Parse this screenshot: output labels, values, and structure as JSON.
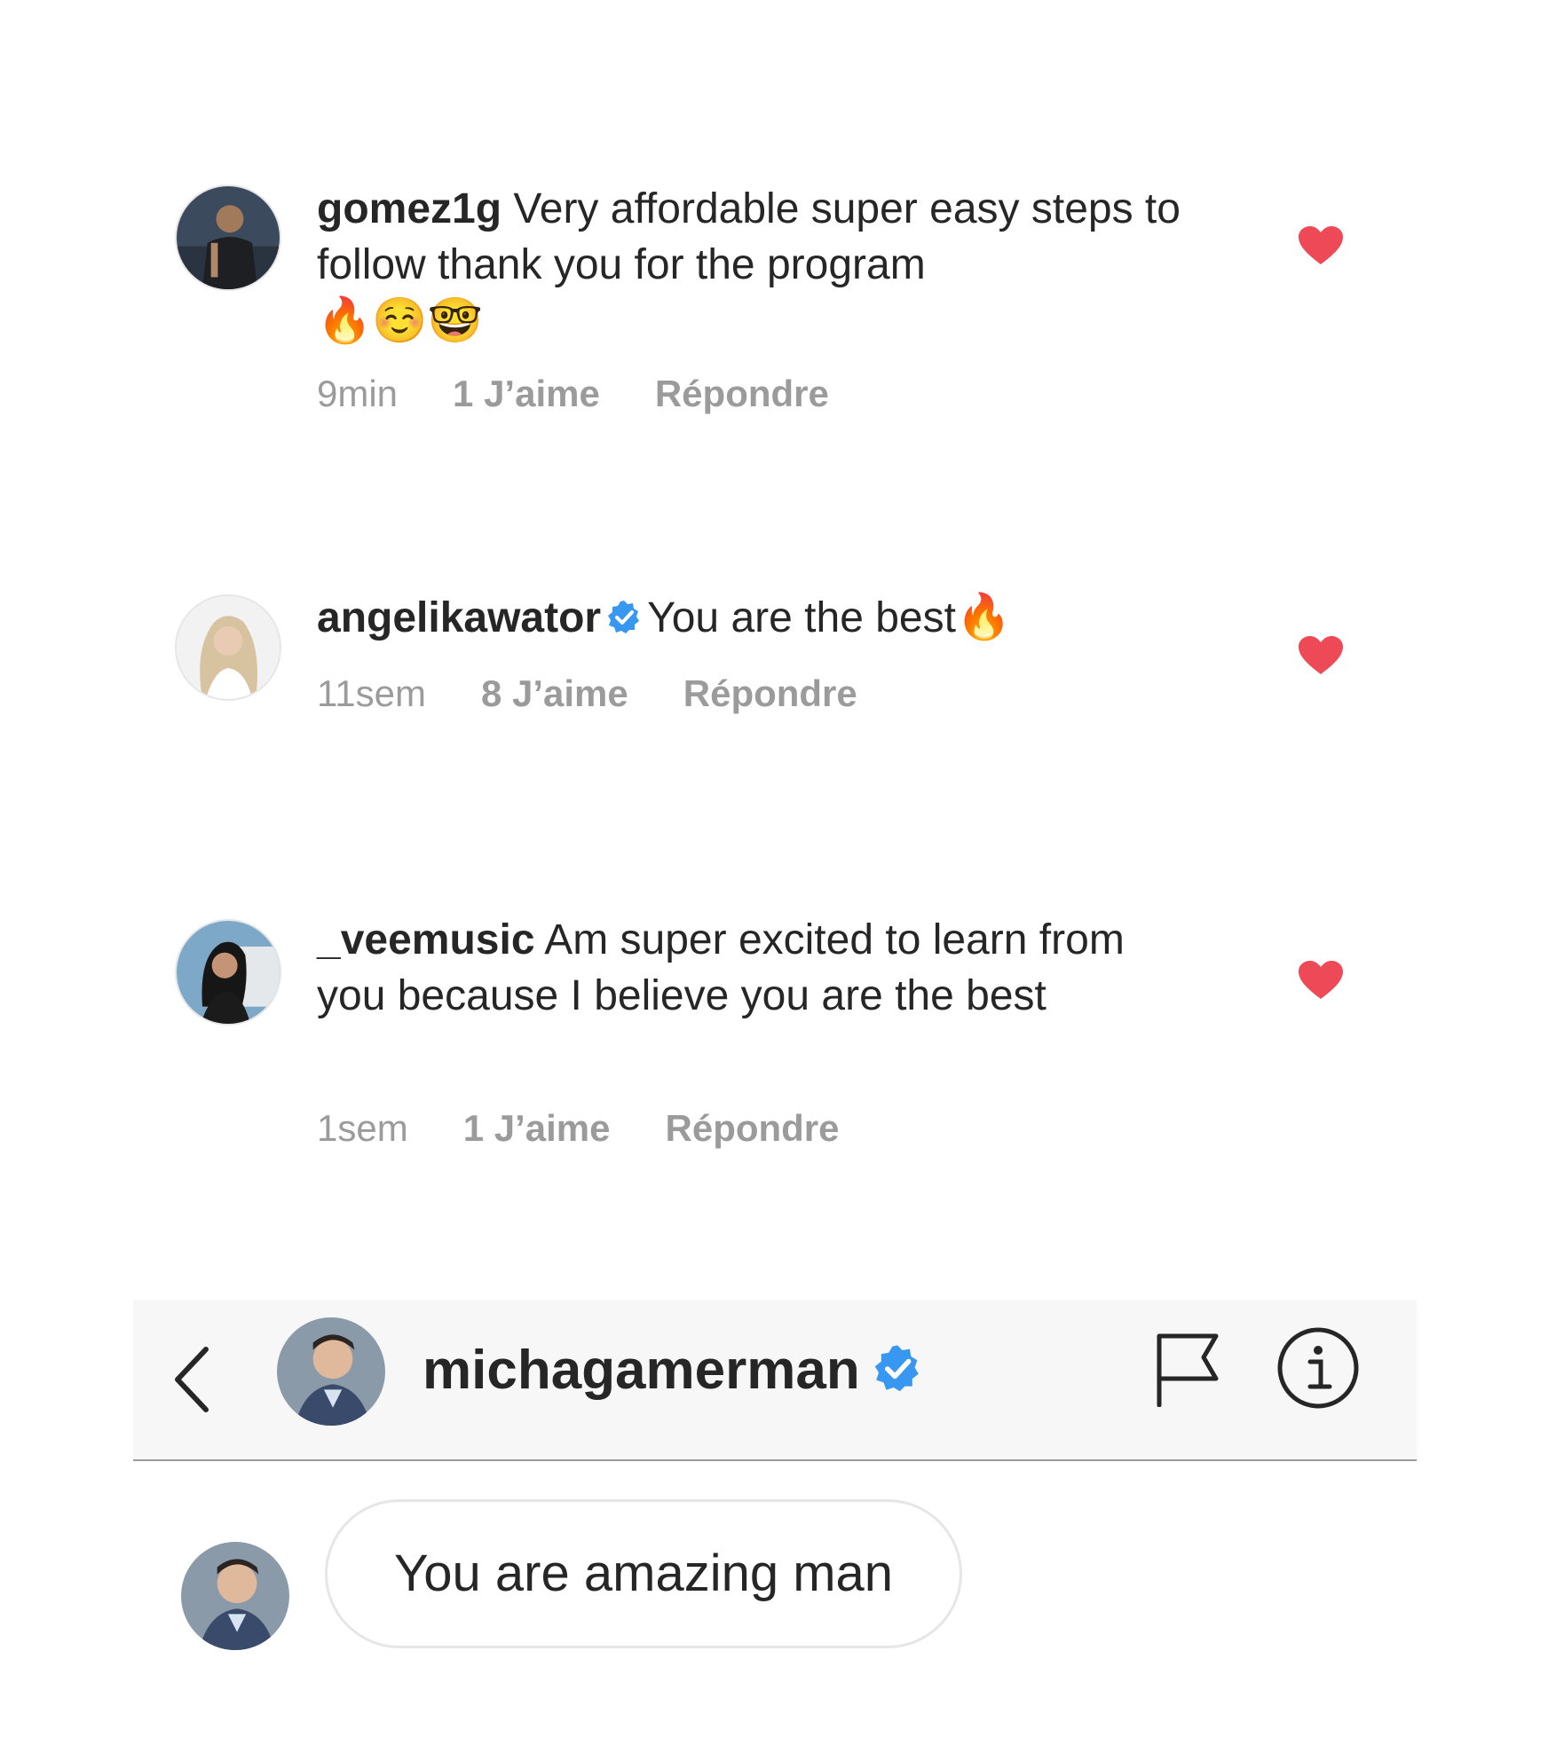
{
  "comments": [
    {
      "username": "gomez1g",
      "verified": false,
      "text": "Very affordable super easy steps to follow thank you for the program",
      "emojis": "🔥☺️🤓",
      "time": "9min",
      "likes": "1 J’aime",
      "reply": "Répondre"
    },
    {
      "username": "angelikawator",
      "verified": true,
      "text": "You are the best",
      "emojis": "🔥",
      "time": "11sem",
      "likes": "8 J’aime",
      "reply": "Répondre"
    },
    {
      "username": "_veemusic",
      "verified": false,
      "text": "Am super excited to learn from you because I believe you are the best",
      "emojis": "",
      "time": "1sem",
      "likes": "1 J’aime",
      "reply": "Répondre"
    }
  ],
  "dm": {
    "username": "michagamerman",
    "verified": true,
    "message": "You are amazing man"
  },
  "colors": {
    "heart": "#ed4956",
    "verified": "#3897f0",
    "meta_text": "#9b9b9b",
    "header_bg": "#f7f7f7"
  },
  "icons": [
    "heart-icon",
    "verified-badge-icon",
    "back-chevron-icon",
    "flag-icon",
    "info-icon"
  ]
}
